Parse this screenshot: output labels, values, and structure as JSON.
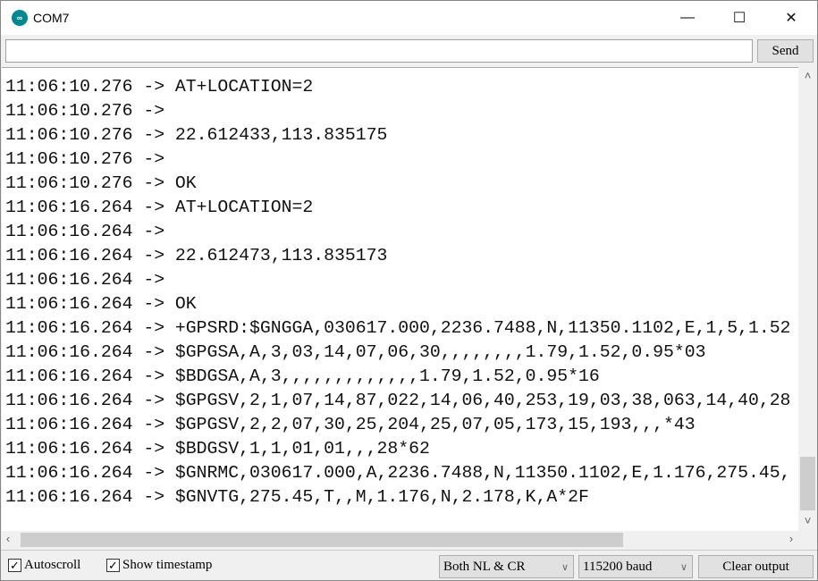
{
  "window": {
    "title": "COM7",
    "icon": "arduino-icon",
    "controls": {
      "minimize": "—",
      "maximize": "☐",
      "close": "✕"
    }
  },
  "input": {
    "value": "",
    "send_label": "Send"
  },
  "output": {
    "lines": [
      "",
      "11:06:10.276 -> AT+LOCATION=2",
      "11:06:10.276 -> ",
      "11:06:10.276 -> 22.612433,113.835175",
      "11:06:10.276 -> ",
      "11:06:10.276 -> OK",
      "11:06:16.264 -> AT+LOCATION=2",
      "11:06:16.264 -> ",
      "11:06:16.264 -> 22.612473,113.835173",
      "11:06:16.264 -> ",
      "11:06:16.264 -> OK",
      "11:06:16.264 -> +GPSRD:$GNGGA,030617.000,2236.7488,N,11350.1102,E,1,5,1.52",
      "11:06:16.264 -> $GPGSA,A,3,03,14,07,06,30,,,,,,,,1.79,1.52,0.95*03",
      "11:06:16.264 -> $BDGSA,A,3,,,,,,,,,,,,,1.79,1.52,0.95*16",
      "11:06:16.264 -> $GPGSV,2,1,07,14,87,022,14,06,40,253,19,03,38,063,14,40,28",
      "11:06:16.264 -> $GPGSV,2,2,07,30,25,204,25,07,05,173,15,193,,,*43",
      "11:06:16.264 -> $BDGSV,1,1,01,01,,,28*62",
      "11:06:16.264 -> $GNRMC,030617.000,A,2236.7488,N,11350.1102,E,1.176,275.45,",
      "11:06:16.264 -> $GNVTG,275.45,T,,M,1.176,N,2.178,K,A*2F"
    ]
  },
  "footer": {
    "autoscroll": {
      "label": "Autoscroll",
      "checked": true
    },
    "show_timestamp": {
      "label": "Show timestamp",
      "checked": true
    },
    "line_ending": "Both NL & CR",
    "baud": "115200 baud",
    "clear_label": "Clear output"
  }
}
